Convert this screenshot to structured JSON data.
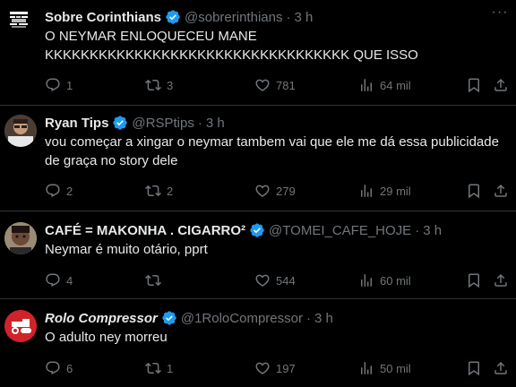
{
  "tweets": [
    {
      "name": "Sobre Corinthians",
      "handle": "@sobrerinthians",
      "time": "3 h",
      "lines": [
        "O NEYMAR ENLOQUECEU MANE",
        "KKKKKKKKKKKKKKKKKKKKKKKKKKKKKKKKKK QUE ISSO"
      ],
      "replies": "1",
      "reposts": "3",
      "likes": "781",
      "views": "64 mil"
    },
    {
      "name": "Ryan Tips",
      "handle": "@RSPtips",
      "time": "3 h",
      "lines": [
        "vou começar a xingar o neymar tambem vai que ele me dá essa publicidade",
        "de graça no story dele"
      ],
      "replies": "2",
      "reposts": "2",
      "likes": "279",
      "views": "29 mil"
    },
    {
      "name": "CAFÉ = MAKONHA . CIGARRO²",
      "handle": "@TOMEI_CAFE_HOJE",
      "time": "3 h",
      "lines": [
        "Neymar é muito otário, pprt"
      ],
      "replies": "4",
      "reposts": "",
      "likes": "544",
      "views": "60 mil"
    },
    {
      "name": "Rolo Compressor",
      "handle": "@1RoloCompressor",
      "time": "3 h",
      "lines": [
        "O adulto ney morreu"
      ],
      "replies": "6",
      "reposts": "1",
      "likes": "197",
      "views": "50 mil"
    }
  ],
  "separator": "·",
  "colors": {
    "background": "#000000",
    "text": "#e7e9ea",
    "muted": "#71767b",
    "verified": "#1d9bf0",
    "border": "#2f3336"
  },
  "icons": [
    "verified-badge-icon",
    "more-icon",
    "reply-icon",
    "repost-icon",
    "like-icon",
    "views-icon",
    "bookmark-icon",
    "share-icon"
  ]
}
